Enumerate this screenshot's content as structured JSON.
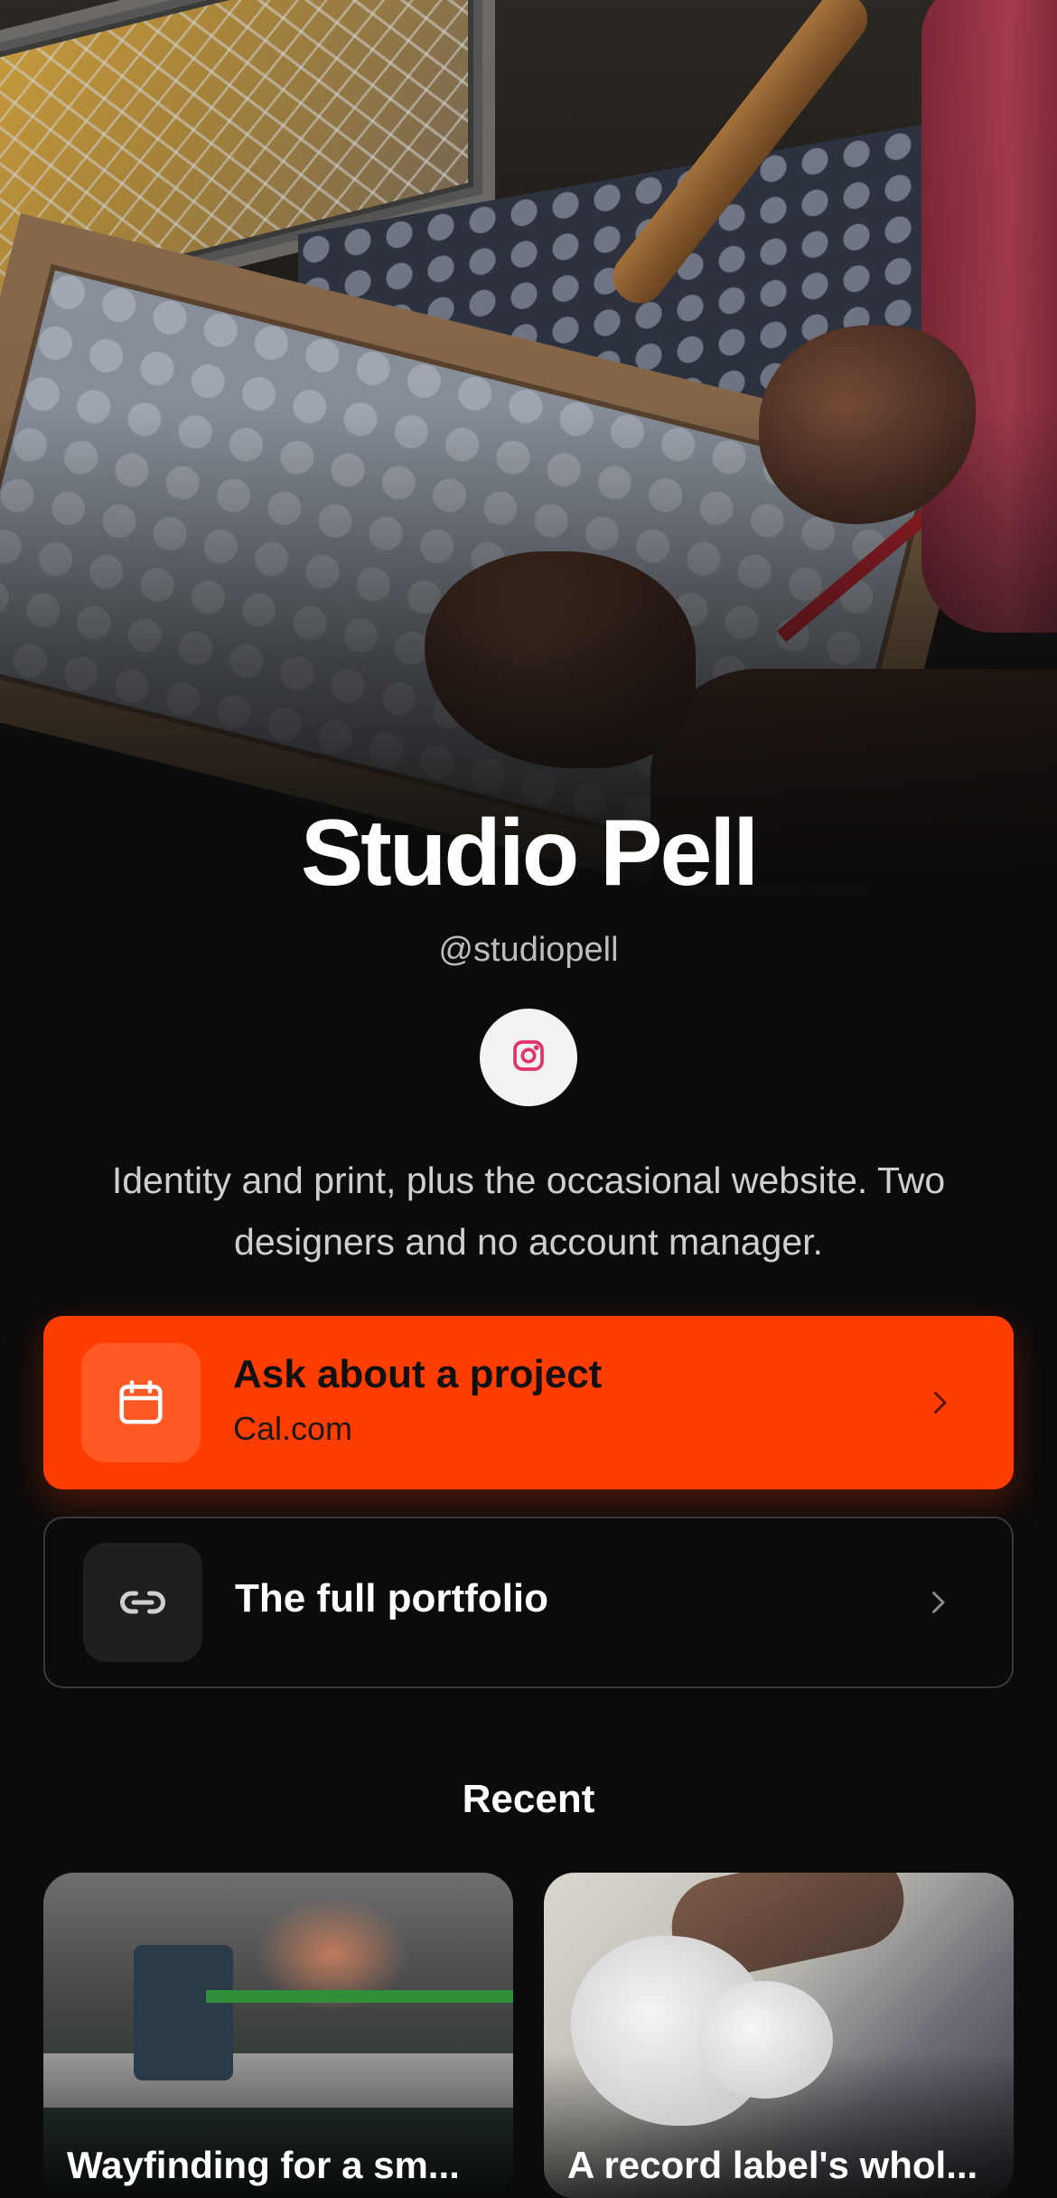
{
  "profile": {
    "name": "Studio Pell",
    "handle": "@studiopell",
    "bio": "Identity and print, plus the occasional website. Two designers and no account manager.",
    "social": [
      {
        "icon": "instagram-icon",
        "color": "#e1306c"
      }
    ]
  },
  "links": [
    {
      "label": "Ask about a project",
      "sublabel": "Cal.com",
      "icon": "calendar-icon",
      "style": "primary",
      "color": "#ff3d00"
    },
    {
      "label": "The full portfolio",
      "icon": "link-icon",
      "style": "outline"
    }
  ],
  "recent": {
    "heading": "Recent",
    "items": [
      {
        "title": "Wayfinding for a sm..."
      },
      {
        "title": "A record label's whol..."
      }
    ]
  },
  "colors": {
    "background": "#0b0b0b",
    "accent": "#ff3d00",
    "card_border": "#3a3a3a"
  }
}
